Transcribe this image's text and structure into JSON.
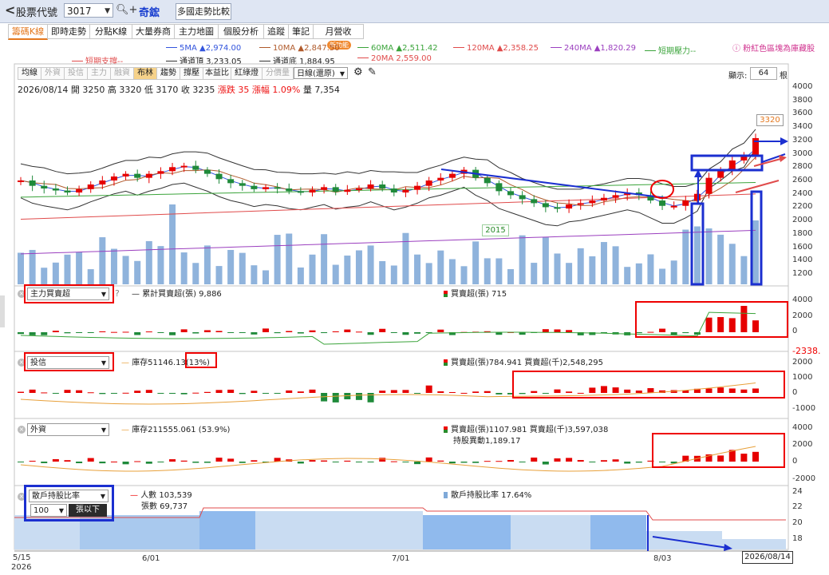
{
  "topbar": {
    "back": "<",
    "label": "股票代號",
    "code": "3017",
    "stock_name": "奇鋐",
    "compare_button": "多國走勢比較"
  },
  "tabs": [
    {
      "label": "籌碼K線",
      "active": true
    },
    {
      "label": "即時走勢"
    },
    {
      "label": "分點K線"
    },
    {
      "label": "大量券商"
    },
    {
      "label": "主力地圖"
    },
    {
      "label": "個股分析"
    },
    {
      "label": "追蹤"
    },
    {
      "label": "筆記"
    },
    {
      "label": "月營收",
      "badge": "新功能"
    }
  ],
  "ma_legend": [
    {
      "label": "5MA ▲2,974.00",
      "color": "#3355dd"
    },
    {
      "label": "10MA ▲2,847.50",
      "color": "#b05a2b"
    },
    {
      "label": "60MA ▲2,511.42",
      "color": "#3ba43b"
    },
    {
      "label": "120MA ▲2,358.25",
      "color": "#e04b4b"
    },
    {
      "label": "240MA ▲1,820.29",
      "color": "#9b3fbf"
    },
    {
      "label": "短期壓力--",
      "color": "#3ba43b"
    },
    {
      "label": "短期支撐--",
      "color": "#e04b4b"
    },
    {
      "label": "通道頂 3,233.05",
      "color": "#333333"
    },
    {
      "label": "通道底 1,884.95",
      "color": "#333333"
    },
    {
      "label": "20MA 2,559.00",
      "color": "#e04b4b"
    }
  ],
  "hide_note": "ⓘ 粉紅色區塊為庫藏股",
  "toolbar": {
    "buttons": [
      "均線",
      "外資",
      "投信",
      "主力",
      "融資",
      "布林",
      "趨勢",
      "撐壓",
      "本益比",
      "紅綠燈",
      "分價量"
    ],
    "dim": [
      1,
      2,
      3,
      4,
      10
    ],
    "on": [
      5
    ],
    "period": "日線(還原)",
    "display_label": "顯示:",
    "display_count": "64",
    "display_unit": "根"
  },
  "ohlc": {
    "date": "2026/08/14",
    "open_label": "開",
    "open": "3250",
    "high_label": "高",
    "high": "3320",
    "low_label": "低",
    "low": "3170",
    "close_label": "收",
    "close": "3235",
    "change_text": "漲跌 35",
    "pct_text": "漲幅 1.09%",
    "vol_text": "量 7,354"
  },
  "price_axis": [
    "4000",
    "3800",
    "3600",
    "3400",
    "3200",
    "3000",
    "2800",
    "2600",
    "2400",
    "2200",
    "2000",
    "1800",
    "1600",
    "1400",
    "1200"
  ],
  "price_high_tag": "3320",
  "price_low_tag": "2015",
  "panel_main_force": {
    "selector": "主力買賣超",
    "cum_label": "累計買賣超(張) 9,886",
    "daily_label": "買賣超(張) 715",
    "axis": [
      "4000",
      "2000",
      "0"
    ],
    "side_note": "-2338."
  },
  "panel_trust": {
    "selector": "投信",
    "inv_label": "庫存51146.13",
    "inv_pct": "(13%)",
    "daily_label": "買賣超(張)784.941 買賣超(千)2,548,295",
    "axis": [
      "2000",
      "1000",
      "0",
      "-1000"
    ]
  },
  "panel_foreign": {
    "selector": "外資",
    "inv_label": "庫存211555.061 (53.9%)",
    "daily_label": "買賣超(張)1107.981 買賣超(千)3,597,038",
    "hold_change": "持股異動1,189.17",
    "axis": [
      "4000",
      "2000",
      "0",
      "-2000"
    ]
  },
  "panel_holders": {
    "selector": "散戶持股比率",
    "sub_value": "100",
    "sub_label": "張以下",
    "people_label": "人數 103,539",
    "shares_label": "張數 69,737",
    "ratio_label": "散戶持股比率 17.64%",
    "axis": [
      "24",
      "22",
      "20",
      "18"
    ]
  },
  "x_axis": {
    "labels": [
      "5/15",
      "6/01",
      "7/01",
      "8/03"
    ],
    "year": "2026",
    "current": "2026/08/14"
  },
  "colors": {
    "up": "#e60000",
    "down": "#1f8a3a",
    "volume": "#8fb3dc",
    "accent": "#e4781e",
    "blue_mark": "#1b2fd0"
  }
}
